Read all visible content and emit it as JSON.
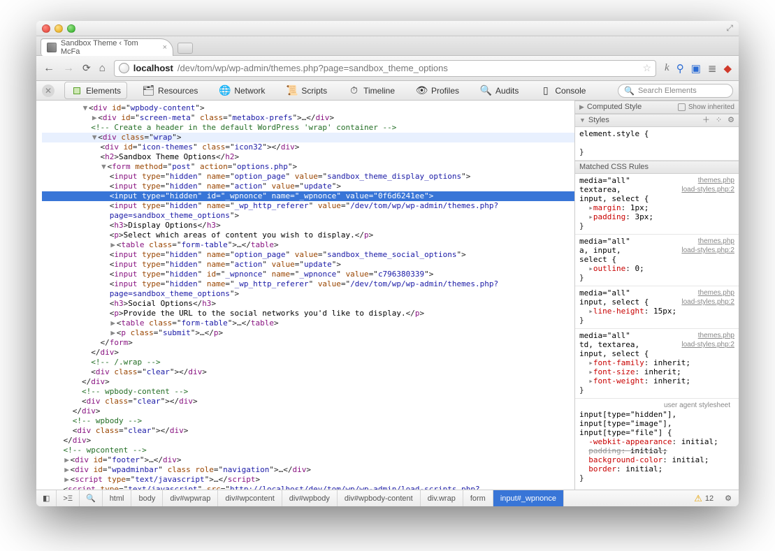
{
  "tab": {
    "title": "Sandbox Theme ‹ Tom McFa"
  },
  "address": {
    "host": "localhost",
    "path": "/dev/tom/wp/wp-admin/themes.php?page=sandbox_theme_options"
  },
  "devtools_panels": {
    "elements": "Elements",
    "resources": "Resources",
    "network": "Network",
    "scripts": "Scripts",
    "timeline": "Timeline",
    "profiles": "Profiles",
    "audits": "Audits",
    "console": "Console"
  },
  "search_placeholder": "Search Elements",
  "dom_lines": [
    {
      "i": 4,
      "html": "<span class='arrow'>▼</span>&lt;<span class='t-tag'>div</span> <span class='t-attr'>id</span>=\"<span class='t-val'>wpbody-content</span>\"&gt;"
    },
    {
      "i": 5,
      "html": "<span class='arrow'>▶</span>&lt;<span class='t-tag'>div</span> <span class='t-attr'>id</span>=\"<span class='t-val'>screen-meta</span>\" <span class='t-attr'>class</span>=\"<span class='t-val'>metabox-prefs</span>\"&gt;…&lt;/<span class='t-tag'>div</span>&gt;"
    },
    {
      "i": 5,
      "html": "<span class='t-cmt'>&lt;!-- Create a header in the default WordPress 'wrap' container --&gt;</span>"
    },
    {
      "i": 5,
      "hover": true,
      "html": "<span class='arrow'>▼</span>&lt;<span class='t-tag'>div</span> <span class='t-attr'>class</span>=\"<span class='t-val'>wrap</span>\"&gt;"
    },
    {
      "i": 6,
      "html": "&lt;<span class='t-tag'>div</span> <span class='t-attr'>id</span>=\"<span class='t-val'>icon-themes</span>\" <span class='t-attr'>class</span>=\"<span class='t-val'>icon32</span>\"&gt;&lt;/<span class='t-tag'>div</span>&gt;"
    },
    {
      "i": 6,
      "html": "&lt;<span class='t-tag'>h2</span>&gt;<span class='t-text'>Sandbox Theme Options</span>&lt;/<span class='t-tag'>h2</span>&gt;"
    },
    {
      "i": 6,
      "html": "<span class='arrow'>▼</span>&lt;<span class='t-tag'>form</span> <span class='t-attr'>method</span>=\"<span class='t-val'>post</span>\" <span class='t-attr'>action</span>=\"<span class='t-val'>options.php</span>\"&gt;"
    },
    {
      "i": 7,
      "html": "&lt;<span class='t-tag'>input</span> <span class='t-attr'>type</span>=\"<span class='t-val'>hidden</span>\" <span class='t-attr'>name</span>=\"<span class='t-val'>option_page</span>\" <span class='t-attr'>value</span>=\"<span class='t-val'>sandbox_theme_display_options</span>\"&gt;"
    },
    {
      "i": 7,
      "html": "&lt;<span class='t-tag'>input</span> <span class='t-attr'>type</span>=\"<span class='t-val'>hidden</span>\" <span class='t-attr'>name</span>=\"<span class='t-val'>action</span>\" <span class='t-attr'>value</span>=\"<span class='t-val'>update</span>\"&gt;"
    },
    {
      "i": 7,
      "hl": true,
      "html": "&lt;<span class='t-tag'>input</span> <span class='t-attr'>type</span>=\"<span class='t-val'>hidden</span>\" <span class='t-attr'>id</span>=\"<span class='t-val'>_wpnonce</span>\" <span class='t-attr'>name</span>=\"<span class='t-val'>_wpnonce</span>\" <span class='t-attr'>value</span>=\"<span class='t-val'>0f6d6241ee</span>\"&gt;"
    },
    {
      "i": 7,
      "html": "&lt;<span class='t-tag'>input</span> <span class='t-attr'>type</span>=\"<span class='t-val'>hidden</span>\" <span class='t-attr'>name</span>=\"<span class='t-val'>_wp_http_referer</span>\" <span class='t-attr'>value</span>=\"<span class='t-val'>/dev/tom/wp/wp-admin/themes.php?</span>"
    },
    {
      "i": 7,
      "html": "<span class='t-val'>page=sandbox_theme_options</span>\"&gt;"
    },
    {
      "i": 7,
      "html": "&lt;<span class='t-tag'>h3</span>&gt;<span class='t-text'>Display Options</span>&lt;/<span class='t-tag'>h3</span>&gt;"
    },
    {
      "i": 7,
      "html": "&lt;<span class='t-tag'>p</span>&gt;<span class='t-text'>Select which areas of content you wish to display.</span>&lt;/<span class='t-tag'>p</span>&gt;"
    },
    {
      "i": 7,
      "html": "<span class='arrow'>▶</span>&lt;<span class='t-tag'>table</span> <span class='t-attr'>class</span>=\"<span class='t-val'>form-table</span>\"&gt;…&lt;/<span class='t-tag'>table</span>&gt;"
    },
    {
      "i": 7,
      "html": "&lt;<span class='t-tag'>input</span> <span class='t-attr'>type</span>=\"<span class='t-val'>hidden</span>\" <span class='t-attr'>name</span>=\"<span class='t-val'>option_page</span>\" <span class='t-attr'>value</span>=\"<span class='t-val'>sandbox_theme_social_options</span>\"&gt;"
    },
    {
      "i": 7,
      "html": "&lt;<span class='t-tag'>input</span> <span class='t-attr'>type</span>=\"<span class='t-val'>hidden</span>\" <span class='t-attr'>name</span>=\"<span class='t-val'>action</span>\" <span class='t-attr'>value</span>=\"<span class='t-val'>update</span>\"&gt;"
    },
    {
      "i": 7,
      "html": "&lt;<span class='t-tag'>input</span> <span class='t-attr'>type</span>=\"<span class='t-val'>hidden</span>\" <span class='t-attr'>id</span>=\"<span class='t-val'>_wpnonce</span>\" <span class='t-attr'>name</span>=\"<span class='t-val'>_wpnonce</span>\" <span class='t-attr'>value</span>=\"<span class='t-val'>c796380339</span>\"&gt;"
    },
    {
      "i": 7,
      "html": "&lt;<span class='t-tag'>input</span> <span class='t-attr'>type</span>=\"<span class='t-val'>hidden</span>\" <span class='t-attr'>name</span>=\"<span class='t-val'>_wp_http_referer</span>\" <span class='t-attr'>value</span>=\"<span class='t-val'>/dev/tom/wp/wp-admin/themes.php?</span>"
    },
    {
      "i": 7,
      "html": "<span class='t-val'>page=sandbox_theme_options</span>\"&gt;"
    },
    {
      "i": 7,
      "html": "&lt;<span class='t-tag'>h3</span>&gt;<span class='t-text'>Social Options</span>&lt;/<span class='t-tag'>h3</span>&gt;"
    },
    {
      "i": 7,
      "html": "&lt;<span class='t-tag'>p</span>&gt;<span class='t-text'>Provide the URL to the social networks you'd like to display.</span>&lt;/<span class='t-tag'>p</span>&gt;"
    },
    {
      "i": 7,
      "html": "<span class='arrow'>▶</span>&lt;<span class='t-tag'>table</span> <span class='t-attr'>class</span>=\"<span class='t-val'>form-table</span>\"&gt;…&lt;/<span class='t-tag'>table</span>&gt;"
    },
    {
      "i": 7,
      "html": "<span class='arrow'>▶</span>&lt;<span class='t-tag'>p</span> <span class='t-attr'>class</span>=\"<span class='t-val'>submit</span>\"&gt;…&lt;/<span class='t-tag'>p</span>&gt;"
    },
    {
      "i": 6,
      "html": "&lt;/<span class='t-tag'>form</span>&gt;"
    },
    {
      "i": 5,
      "html": "&lt;/<span class='t-tag'>div</span>&gt;"
    },
    {
      "i": 5,
      "html": "<span class='t-cmt'>&lt;!-- /.wrap --&gt;</span>"
    },
    {
      "i": 5,
      "html": "&lt;<span class='t-tag'>div</span> <span class='t-attr'>class</span>=\"<span class='t-val'>clear</span>\"&gt;&lt;/<span class='t-tag'>div</span>&gt;"
    },
    {
      "i": 4,
      "html": "&lt;/<span class='t-tag'>div</span>&gt;"
    },
    {
      "i": 4,
      "html": "<span class='t-cmt'>&lt;!-- wpbody-content --&gt;</span>"
    },
    {
      "i": 4,
      "html": "&lt;<span class='t-tag'>div</span> <span class='t-attr'>class</span>=\"<span class='t-val'>clear</span>\"&gt;&lt;/<span class='t-tag'>div</span>&gt;"
    },
    {
      "i": 3,
      "html": "&lt;/<span class='t-tag'>div</span>&gt;"
    },
    {
      "i": 3,
      "html": "<span class='t-cmt'>&lt;!-- wpbody --&gt;</span>"
    },
    {
      "i": 3,
      "html": "&lt;<span class='t-tag'>div</span> <span class='t-attr'>class</span>=\"<span class='t-val'>clear</span>\"&gt;&lt;/<span class='t-tag'>div</span>&gt;"
    },
    {
      "i": 2,
      "html": "&lt;/<span class='t-tag'>div</span>&gt;"
    },
    {
      "i": 2,
      "html": "<span class='t-cmt'>&lt;!-- wpcontent --&gt;</span>"
    },
    {
      "i": 2,
      "html": "<span class='arrow'>▶</span>&lt;<span class='t-tag'>div</span> <span class='t-attr'>id</span>=\"<span class='t-val'>footer</span>\"&gt;…&lt;/<span class='t-tag'>div</span>&gt;"
    },
    {
      "i": 2,
      "html": "<span class='arrow'>▶</span>&lt;<span class='t-tag'>div</span> <span class='t-attr'>id</span>=\"<span class='t-val'>wpadminbar</span>\" <span class='t-attr'>class role</span>=\"<span class='t-val'>navigation</span>\"&gt;…&lt;/<span class='t-tag'>div</span>&gt;"
    },
    {
      "i": 2,
      "html": "<span class='arrow'>▶</span>&lt;<span class='t-tag'>script</span> <span class='t-attr'>type</span>=\"<span class='t-val'>text/javascript</span>\"&gt;…&lt;/<span class='t-tag'>script</span>&gt;"
    },
    {
      "i": 2,
      "html": "&lt;<span class='t-tag'>script</span> <span class='t-attr'>type</span>=\"<span class='t-val'>text/javascript</span>\" <span class='t-attr'>src</span>=\"<span class='t-val'>http://localhost/dev/tom/wp/wp-admin/load-scripts.php?</span>"
    }
  ],
  "styles": {
    "computed_label": "Computed Style",
    "show_inherited": "Show inherited",
    "styles_label": "Styles",
    "matched_label": "Matched CSS Rules",
    "element_style": "element.style {",
    "rules": [
      {
        "media": "media=\"all\"",
        "src": "themes.php",
        "sel": "textarea,",
        "src2": "load-styles.php:2",
        "sel2": "input, select {",
        "props": [
          {
            "p": "margin",
            "v": "1px;"
          },
          {
            "p": "padding",
            "v": "3px;"
          }
        ]
      },
      {
        "media": "media=\"all\"",
        "src": "themes.php",
        "sel": "a, input,",
        "src2": "load-styles.php:2",
        "sel2": "select {",
        "props": [
          {
            "p": "outline",
            "v": "0;"
          }
        ]
      },
      {
        "media": "media=\"all\"",
        "src": "themes.php",
        "sel": "input, select {",
        "src2": "load-styles.php:2",
        "props": [
          {
            "p": "line-height",
            "v": "15px;"
          }
        ]
      },
      {
        "media": "media=\"all\"",
        "src": "themes.php",
        "sel": "td, textarea,",
        "src2": "load-styles.php:2",
        "sel2": "input, select {",
        "props": [
          {
            "p": "font-family",
            "v": "inherit;"
          },
          {
            "p": "font-size",
            "v": "inherit;"
          },
          {
            "p": "font-weight",
            "v": "inherit;"
          }
        ]
      }
    ],
    "ua_label": "user agent stylesheet",
    "ua_sel": [
      "input[type=\"hidden\"],",
      "input[type=\"image\"],",
      "input[type=\"file\"] {"
    ],
    "ua_props": [
      {
        "p": "-webkit-appearance",
        "v": "initial;",
        "strike": false
      },
      {
        "p": "padding",
        "v": "initial;",
        "strike": true
      },
      {
        "p": "background-color",
        "v": "initial;",
        "strike": false
      },
      {
        "p": "border",
        "v": "initial;",
        "strike": false
      }
    ]
  },
  "breadcrumbs": [
    "html",
    "body",
    "div#wpwrap",
    "div#wpcontent",
    "div#wpbody",
    "div#wpbody-content",
    "div.wrap",
    "form",
    "input#_wpnonce"
  ],
  "warnings": "12"
}
